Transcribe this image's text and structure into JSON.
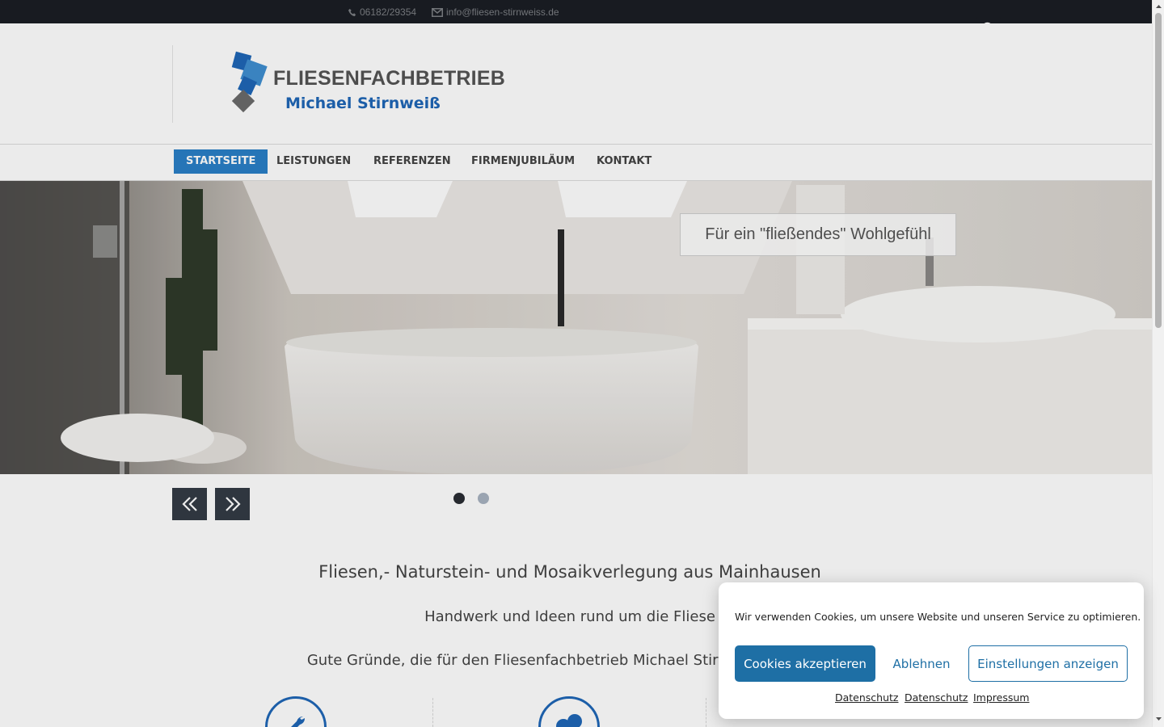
{
  "topbar": {
    "phone": "06182/29354",
    "email": "info@fliesen-stirnweiss.de"
  },
  "logo": {
    "line1": "FLIESENFACHBETRIEB",
    "line2": "Michael Stirnweiß"
  },
  "nav": {
    "items": [
      {
        "label": "STARTSEITE",
        "active": true
      },
      {
        "label": "LEISTUNGEN",
        "active": false
      },
      {
        "label": "REFERENZEN",
        "active": false
      },
      {
        "label": "FIRMENJUBILÄUM",
        "active": false
      },
      {
        "label": "KONTAKT",
        "active": false
      }
    ]
  },
  "hero": {
    "caption": "Für ein \"fließendes\" Wohlgefühl",
    "slide_count": 2,
    "active_slide": 1
  },
  "content": {
    "headline": "Fliesen,- Naturstein- und Mosaikverlegung aus Mainhausen",
    "subline": "Handwerk und Ideen rund um die Fliese",
    "reasons": "Gute Gründe, die für den Fliesenfachbetrieb Michael Stirnweiß sprechen"
  },
  "cookie": {
    "message": "Wir verwenden Cookies, um unsere Website und unseren Service zu optimieren.",
    "accept": "Cookies akzeptieren",
    "deny": "Ablehnen",
    "settings": "Einstellungen anzeigen",
    "links": [
      "Datenschutz",
      "Datenschutz",
      "Impressum"
    ]
  },
  "colors": {
    "topbar_bg": "#1b1e24",
    "nav_active": "#2a7fc7",
    "brand_blue": "#1f67b7",
    "cookie_accent": "#1e6fa5"
  }
}
